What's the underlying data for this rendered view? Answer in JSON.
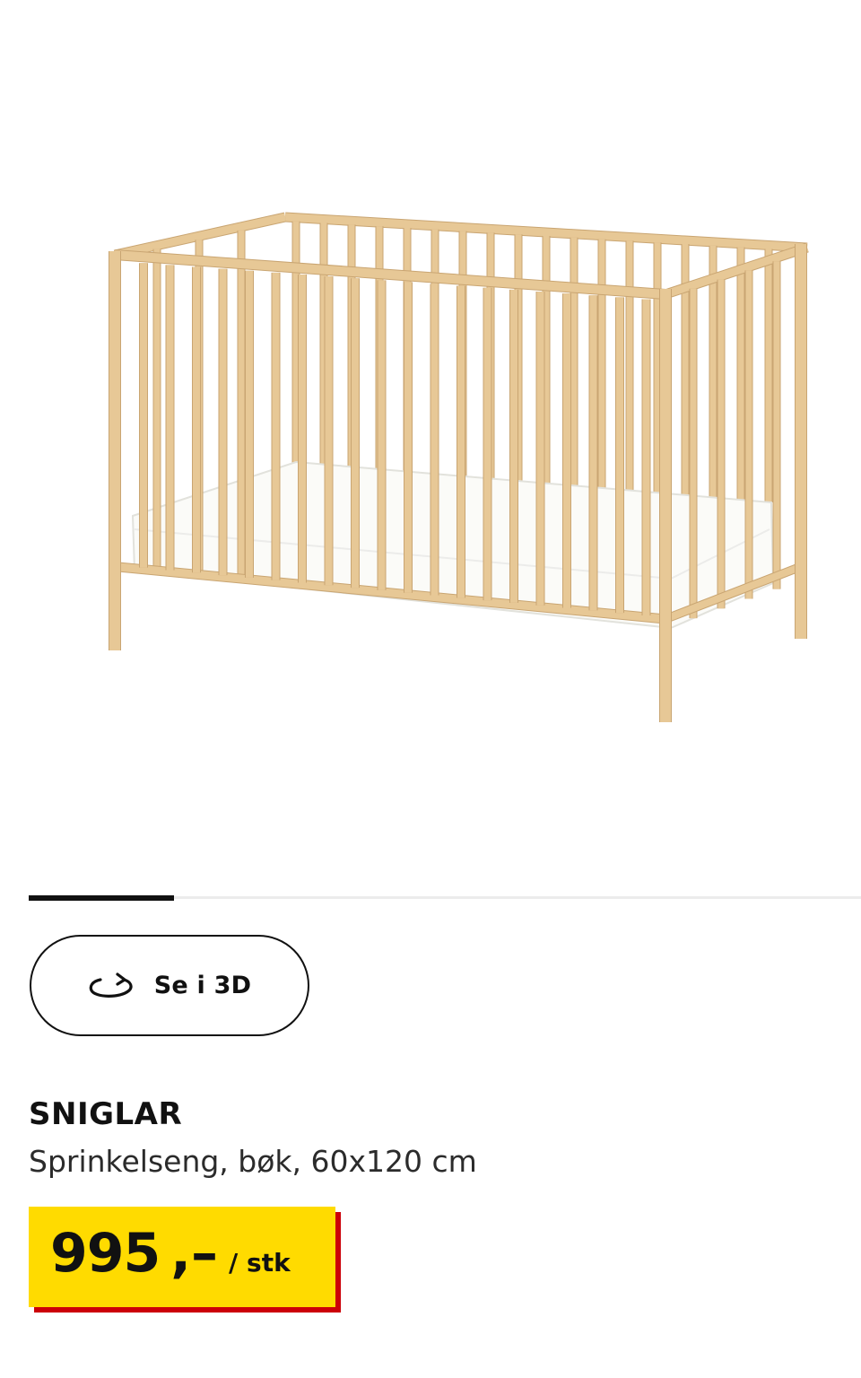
{
  "gallery": {
    "image_alt": "SNIGLAR sprinkelseng i bøk med madrass",
    "progress_fraction": 0.175
  },
  "view_3d": {
    "label": "Se i 3D",
    "icon": "rotate-icon"
  },
  "product": {
    "name": "SNIGLAR",
    "description": "Sprinkelseng, bøk, 60x120 cm"
  },
  "price": {
    "amount": "995",
    "suffix": ",–",
    "unit": "/ stk",
    "tag_color": "#ffdb00",
    "shadow_color": "#cc0008"
  },
  "colors": {
    "wood": "#e7c896",
    "wood_dark": "#c9a572",
    "mattress": "#fbfbf8"
  }
}
